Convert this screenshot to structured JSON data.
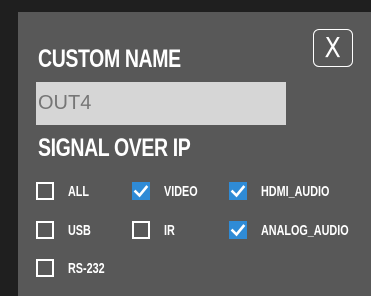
{
  "dialog": {
    "title": "CUSTOM NAME",
    "close_label": "X",
    "name_value": "OUT4",
    "section_title": "SIGNAL OVER IP"
  },
  "options": [
    {
      "label": "ALL",
      "checked": false
    },
    {
      "label": "VIDEO",
      "checked": true
    },
    {
      "label": "HDMI_AUDIO",
      "checked": true
    },
    {
      "label": "USB",
      "checked": false
    },
    {
      "label": "IR",
      "checked": false
    },
    {
      "label": "ANALOG_AUDIO",
      "checked": true
    },
    {
      "label": "RS-232",
      "checked": false
    }
  ],
  "colors": {
    "panel_bg": "#585858",
    "checkbox_checked": "#2f8bd6",
    "input_bg": "#d6d6d6",
    "input_text": "#767676"
  }
}
